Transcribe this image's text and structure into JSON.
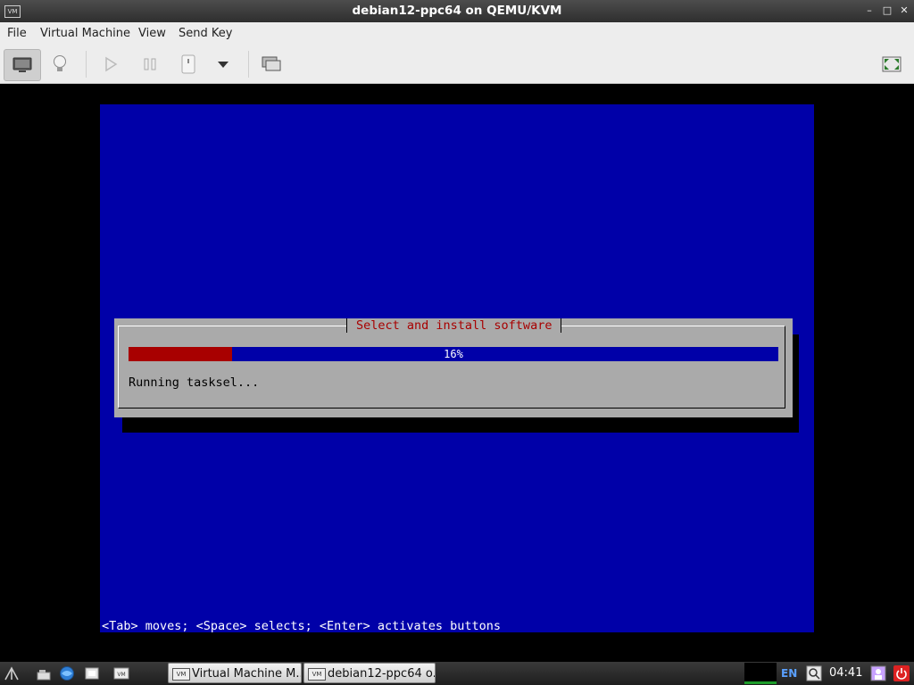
{
  "window": {
    "title": "debian12-ppc64 on QEMU/KVM",
    "app_icon": "vm-icon",
    "controls": [
      "minimize-icon",
      "maximize-icon",
      "close-icon"
    ]
  },
  "menu": {
    "items": [
      "File",
      "Virtual Machine",
      "View",
      "Send Key"
    ]
  },
  "toolbar": {
    "buttons": [
      "console-icon",
      "lightbulb-icon",
      "play-icon",
      "pause-icon",
      "shutdown-icon",
      "dropdown-icon",
      "snapshot-icon",
      "fullscreen-icon"
    ]
  },
  "installer": {
    "dialog_title": "Select and install software",
    "progress_percent": 16,
    "progress_label": "16%",
    "status": "Running tasksel...",
    "help_line": "<Tab> moves; <Space> selects; <Enter> activates buttons",
    "colors": {
      "screen": "#0000a8",
      "dialog": "#aaaaaa",
      "title": "#a80000",
      "progress_fill": "#a80000"
    }
  },
  "taskbar": {
    "tasks": [
      {
        "label": "Virtual Machine M..."
      },
      {
        "label": "debian12-ppc64 o..."
      }
    ],
    "language": "EN",
    "clock": "04:41"
  }
}
